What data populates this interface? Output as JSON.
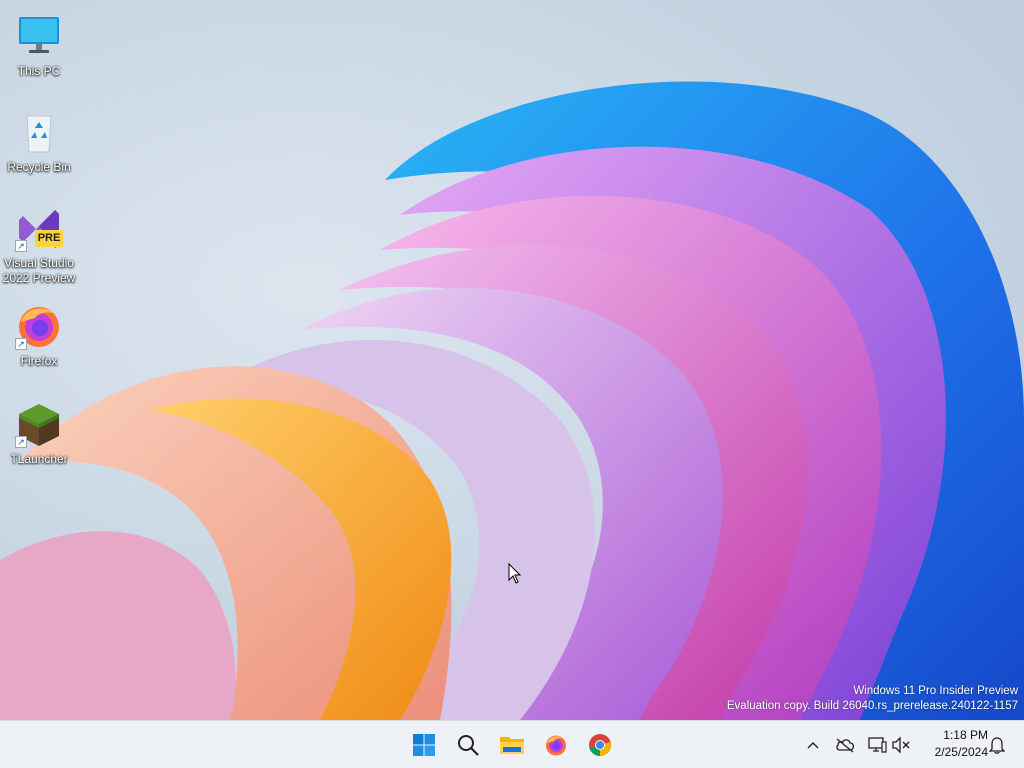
{
  "desktop": {
    "icons": [
      {
        "label": "This PC",
        "icon": "this-pc-icon"
      },
      {
        "label": "Recycle Bin",
        "icon": "recycle-bin-icon"
      },
      {
        "label": "Visual Studio\n2022 Preview",
        "icon": "visual-studio-icon",
        "badge": "PRE"
      },
      {
        "label": "Firefox",
        "icon": "firefox-icon"
      },
      {
        "label": "TLauncher",
        "icon": "tlauncher-icon"
      }
    ],
    "watermark": {
      "line1": "Windows 11 Pro Insider Preview",
      "line2": "Evaluation copy. Build 26040.rs_prerelease.240122-1157"
    }
  },
  "taskbar": {
    "pinned": [
      {
        "name": "start",
        "icon": "windows-start-icon"
      },
      {
        "name": "search",
        "icon": "search-icon"
      },
      {
        "name": "file-explorer",
        "icon": "folder-icon"
      },
      {
        "name": "firefox",
        "icon": "firefox-icon"
      },
      {
        "name": "chrome",
        "icon": "chrome-icon"
      }
    ],
    "tray": [
      "chevron-up-icon",
      "onedrive-offline-icon",
      "network-icon",
      "volume-muted-icon"
    ],
    "clock": {
      "time": "1:18 PM",
      "date": "2/25/2024"
    },
    "notification_icon": "bell-icon"
  },
  "colors": {
    "taskbar_bg": "#eef1f5",
    "windows_blue": "#0078d4"
  }
}
